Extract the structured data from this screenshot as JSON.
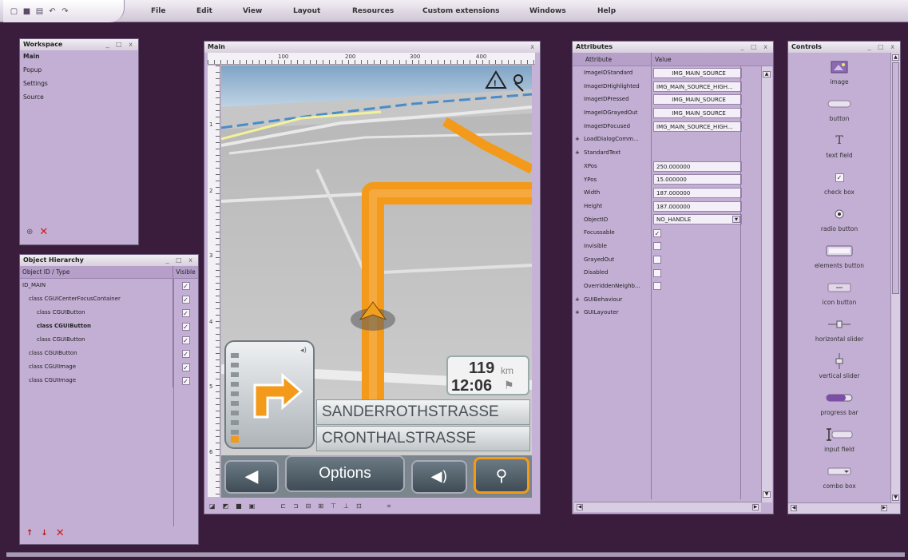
{
  "menubar": {
    "items": [
      "File",
      "Edit",
      "View",
      "Layout",
      "Resources",
      "Custom extensions",
      "Windows",
      "Help"
    ],
    "quick_icons": [
      "new-icon",
      "save-icon",
      "open-icon",
      "undo-icon",
      "redo-icon"
    ]
  },
  "workspace": {
    "title": "Workspace",
    "items": [
      "Main",
      "Popup",
      "Settings",
      "Source"
    ],
    "selected": "Main"
  },
  "hierarchy": {
    "title": "Object Hierarchy",
    "col_id": "Object ID / Type",
    "col_visible": "Visible",
    "rows": [
      {
        "label": "ID_MAIN",
        "checked": true,
        "bold": false
      },
      {
        "label": "class CGUICenterFocusContainer",
        "checked": true,
        "bold": false
      },
      {
        "label": "class CGUIButton",
        "checked": true,
        "bold": false
      },
      {
        "label": "class CGUIButton",
        "checked": true,
        "bold": true
      },
      {
        "label": "class CGUIButton",
        "checked": true,
        "bold": false
      },
      {
        "label": "class CGUIButton",
        "checked": true,
        "bold": false
      },
      {
        "label": "class CGUIImage",
        "checked": true,
        "bold": false
      },
      {
        "label": "class CGUIImage",
        "checked": true,
        "bold": false
      }
    ]
  },
  "main": {
    "title": "Main",
    "ruler_h": [
      "100",
      "200",
      "300",
      "400"
    ],
    "ruler_v": [
      "1",
      "2",
      "3",
      "4",
      "5",
      "6"
    ],
    "nav": {
      "distance": "119",
      "distance_unit": "km",
      "time": "12:06",
      "street_next": "SANDERROTHSTRASSE",
      "street_current": "CRONTHALSTRASSE",
      "options_label": "Options"
    }
  },
  "attributes": {
    "title": "Attributes",
    "col_attr": "Attribute",
    "col_value": "Value",
    "rows": [
      {
        "name": "ImageIDStandard",
        "value": "IMG_MAIN_SOURCE",
        "kind": "box-center"
      },
      {
        "name": "ImageIDHighlighted",
        "value": "IMG_MAIN_SOURCE_HIGH...",
        "kind": "box"
      },
      {
        "name": "ImageIDPressed",
        "value": "IMG_MAIN_SOURCE",
        "kind": "box-center"
      },
      {
        "name": "ImageIDGrayedOut",
        "value": "IMG_MAIN_SOURCE",
        "kind": "box-center"
      },
      {
        "name": "ImageIDFocused",
        "value": "IMG_MAIN_SOURCE_HIGH...",
        "kind": "box"
      },
      {
        "name": "LoadDialogComm...",
        "value": "",
        "kind": "group"
      },
      {
        "name": "StandardText",
        "value": "",
        "kind": "group"
      },
      {
        "name": "XPos",
        "value": "250.000000",
        "kind": "box"
      },
      {
        "name": "YPos",
        "value": "15.000000",
        "kind": "box"
      },
      {
        "name": "Width",
        "value": "187.000000",
        "kind": "box"
      },
      {
        "name": "Height",
        "value": "187.000000",
        "kind": "box"
      },
      {
        "name": "ObjectID",
        "value": "NO_HANDLE",
        "kind": "combo"
      },
      {
        "name": "Focussable",
        "value": "",
        "kind": "check-on"
      },
      {
        "name": "Invisible",
        "value": "",
        "kind": "check-off"
      },
      {
        "name": "GrayedOut",
        "value": "",
        "kind": "check-off"
      },
      {
        "name": "Disabled",
        "value": "",
        "kind": "check-off"
      },
      {
        "name": "OverriddenNeighb...",
        "value": "",
        "kind": "check-off"
      },
      {
        "name": "GUIBehaviour",
        "value": "",
        "kind": "group"
      },
      {
        "name": "GUILayouter",
        "value": "",
        "kind": "group"
      }
    ]
  },
  "controls": {
    "title": "Controls",
    "items": [
      {
        "label": "image",
        "icon": "image-icon"
      },
      {
        "label": "button",
        "icon": "button-icon"
      },
      {
        "label": "text field",
        "icon": "text-field-icon"
      },
      {
        "label": "check box",
        "icon": "check-box-icon"
      },
      {
        "label": "radio button",
        "icon": "radio-button-icon"
      },
      {
        "label": "elements button",
        "icon": "elements-button-icon"
      },
      {
        "label": "icon button",
        "icon": "icon-button-icon"
      },
      {
        "label": "horizontal slider",
        "icon": "horizontal-slider-icon"
      },
      {
        "label": "vertical slider",
        "icon": "vertical-slider-icon"
      },
      {
        "label": "progress bar",
        "icon": "progress-bar-icon"
      },
      {
        "label": "input field",
        "icon": "input-field-icon"
      },
      {
        "label": "combo box",
        "icon": "combo-box-icon"
      }
    ]
  },
  "colors": {
    "background": "#3a1c3c",
    "panel": "#c3aed4",
    "route": "#f39a1b",
    "accent": "#7b4fa6"
  }
}
